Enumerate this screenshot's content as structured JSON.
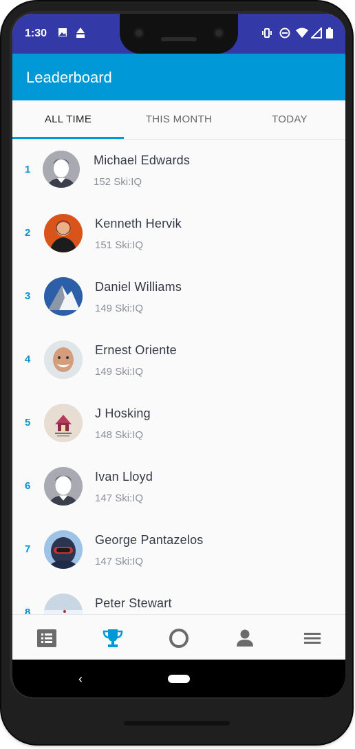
{
  "status_bar": {
    "time": "1:30"
  },
  "app_bar": {
    "title": "Leaderboard"
  },
  "tabs": [
    {
      "label": "ALL TIME",
      "active": true
    },
    {
      "label": "THIS MONTH",
      "active": false
    },
    {
      "label": "TODAY",
      "active": false
    }
  ],
  "leaderboard": [
    {
      "rank": "1",
      "name": "Michael Edwards",
      "score": "152 Ski:IQ",
      "avatar": "default-avatar"
    },
    {
      "rank": "2",
      "name": "Kenneth Hervik",
      "score": "151 Ski:IQ",
      "avatar": "photo-avatar"
    },
    {
      "rank": "3",
      "name": "Daniel Williams",
      "score": "149 Ski:IQ",
      "avatar": "mountain-avatar"
    },
    {
      "rank": "4",
      "name": "Ernest Oriente",
      "score": "149 Ski:IQ",
      "avatar": "photo-avatar"
    },
    {
      "rank": "5",
      "name": "J Hosking",
      "score": "148 Ski:IQ",
      "avatar": "logo-avatar"
    },
    {
      "rank": "6",
      "name": "Ivan Lloyd",
      "score": "147 Ski:IQ",
      "avatar": "default-avatar"
    },
    {
      "rank": "7",
      "name": "George Pantazelos",
      "score": "147 Ski:IQ",
      "avatar": "helmet-avatar"
    },
    {
      "rank": "8",
      "name": "Peter Stewart",
      "score": "",
      "avatar": "snow-avatar"
    }
  ],
  "bottom_nav": [
    {
      "icon": "list-icon",
      "active": false
    },
    {
      "icon": "trophy-icon",
      "active": true
    },
    {
      "icon": "circle-icon",
      "active": false
    },
    {
      "icon": "person-icon",
      "active": false
    },
    {
      "icon": "menu-icon",
      "active": false
    }
  ],
  "colors": {
    "accent": "#0098d7",
    "status_bar": "#3339a6",
    "rank": "#0b8fcf"
  }
}
